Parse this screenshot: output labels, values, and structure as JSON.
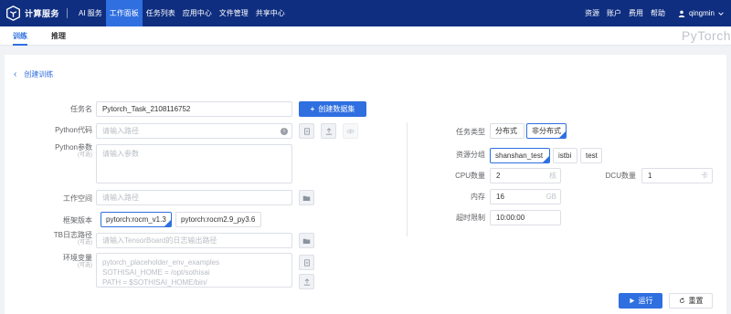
{
  "brand": {
    "name": "计算服务"
  },
  "nav": {
    "service": "AI 服务",
    "items": [
      "工作面板",
      "任务列表",
      "应用中心",
      "文件管理",
      "共享中心"
    ],
    "right_items": [
      "资源",
      "账户",
      "费用",
      "帮助"
    ],
    "username": "qingmin"
  },
  "tabs": [
    "训练",
    "推理"
  ],
  "framework_title": "PyTorch",
  "back_label": "创建训练",
  "form": {
    "task_name_label": "任务名",
    "task_name_value": "Pytorch_Task_2108116752",
    "create_dataset_label": "创建数据集",
    "python_code_label": "Python代码",
    "python_code_placeholder": "请输入路径",
    "python_params_label": "Python参数",
    "optional": "(可选)",
    "python_params_placeholder": "请输入参数",
    "workdir_label": "工作空间",
    "workdir_placeholder": "请输入路径",
    "framework_version_label": "框架版本",
    "framework_versions": [
      "pytorch:rocm_v1.3",
      "pytorch:rocm2.9_py3.6"
    ],
    "tb_label": "TB日志路径",
    "tb_placeholder": "请输入TensorBoard的日志输出路径",
    "env_label": "环境变量",
    "env_lines": [
      "pytorch_placeholder_env_examples",
      "SOTHISAI_HOME = /opt/sothisai",
      "PATH = $SOTHISAI_HOME/bin/"
    ]
  },
  "right": {
    "task_type_label": "任务类型",
    "task_types": [
      "分布式",
      "非分布式"
    ],
    "resource_group_label": "资源分组",
    "resource_groups": [
      "shanshan_test",
      "istbi",
      "test"
    ],
    "cpu_label": "CPU数量",
    "cpu_value": "2",
    "cpu_unit": "核",
    "dcu_label": "DCU数量",
    "dcu_value": "1",
    "dcu_unit": "卡",
    "mem_label": "内存",
    "mem_value": "16",
    "mem_unit": "GB",
    "timeout_label": "超时限制",
    "timeout_value": "10:00:00"
  },
  "actions": {
    "run": "运行",
    "reset": "重置"
  }
}
